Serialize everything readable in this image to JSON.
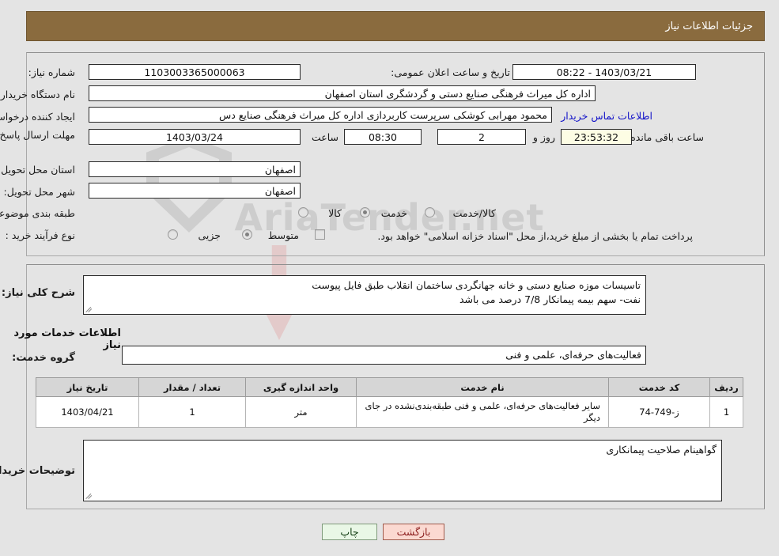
{
  "header": {
    "title": "جزئیات اطلاعات نیاز"
  },
  "form": {
    "need_number_label": "شماره نیاز:",
    "need_number_value": "1103003365000063",
    "announce_label": "تاریخ و ساعت اعلان عمومی:",
    "announce_value": "1403/03/21 - 08:22",
    "buyer_org_label": "نام دستگاه خریدار:",
    "buyer_org_value": "اداره کل میراث فرهنگی  صنایع دستی و گردشگری استان اصفهان",
    "creator_label": "ایجاد کننده درخواست:",
    "creator_value": "محمود مهرابی کوشکی سرپرست کاربردازی اداره کل میراث فرهنگی  صنایع دس",
    "contact_link": "اطلاعات تماس خریدار",
    "deadline_label": "مهلت ارسال پاسخ: تا تاریخ:",
    "deadline_date": "1403/03/24",
    "hour_label": "ساعت",
    "deadline_time": "08:30",
    "days_value": "2",
    "days_label": "روز و",
    "timer_value": "23:53:32",
    "remaining_label": "ساعت باقی مانده",
    "province_label": "استان محل تحویل:",
    "province_value": "اصفهان",
    "city_label": "شهر محل تحویل:",
    "city_value": "اصفهان",
    "category_label": "طبقه بندی موضوعی:",
    "category_options": [
      {
        "label": "کالا",
        "selected": false
      },
      {
        "label": "خدمت",
        "selected": true
      },
      {
        "label": "کالا/خدمت",
        "selected": false
      }
    ],
    "process_label": "نوع فرآیند خرید :",
    "process_options": [
      {
        "label": "جزیی",
        "selected": false
      },
      {
        "label": "متوسط",
        "selected": true
      }
    ],
    "treasury_checkbox_label": "پرداخت تمام یا بخشی از مبلغ خرید،از محل \"اسناد خزانه اسلامی\" خواهد بود.",
    "treasury_checked": false
  },
  "description": {
    "label": "شرح کلی نیاز:",
    "line1": "تاسیسات موزه صنایع دستی و خانه جهانگردی ساختمان انقلاب طبق فایل پیوست",
    "line2": "نفت- سهم بیمه پیمانکار 7/8 درصد می باشد"
  },
  "services_section": {
    "title": "اطلاعات خدمات مورد نیاز",
    "group_label": "گروه خدمت:",
    "group_value": "فعالیت‌های حرفه‌ای، علمی و فنی"
  },
  "table": {
    "headers": [
      "ردیف",
      "کد خدمت",
      "نام خدمت",
      "واحد اندازه گیری",
      "تعداد / مقدار",
      "تاریخ نیاز"
    ],
    "rows": [
      {
        "row": "1",
        "code": "ز-749-74",
        "name": "سایر فعالیت‌های حرفه‌ای، علمی و فنی طبقه‌بندی‌نشده در جای دیگر",
        "unit": "متر",
        "qty": "1",
        "date": "1403/04/21"
      }
    ]
  },
  "buyer_notes": {
    "label": "توضیحات خریدار:",
    "value": "گواهینام صلاحیت پیمانکاری"
  },
  "buttons": {
    "print": "چاپ",
    "back": "بازگشت"
  },
  "watermark": {
    "text": "AriaTender.net"
  },
  "colors": {
    "header_bg": "#8a6b3e",
    "panel_bg": "#e4e4e4",
    "link": "#1414c8",
    "timer_bg": "#fdfde4",
    "print_bg": "#e9f7e6",
    "back_bg": "#fbd9d1"
  }
}
